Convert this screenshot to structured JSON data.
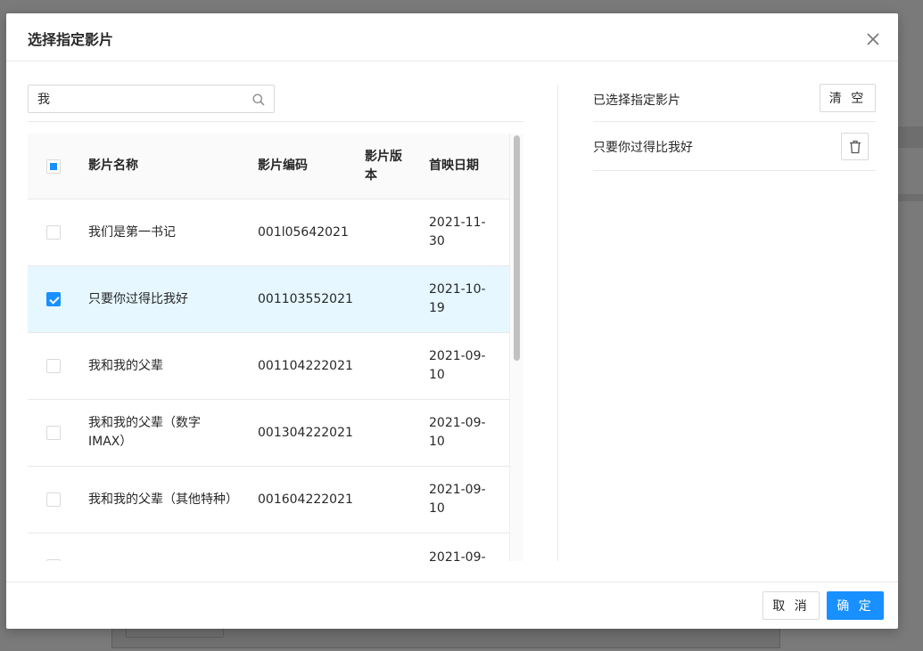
{
  "modal": {
    "title": "选择指定影片",
    "close_icon": "close-icon"
  },
  "search": {
    "value": "我",
    "placeholder": "",
    "icon": "search-icon"
  },
  "table": {
    "columns": [
      "影片名称",
      "影片编码",
      "影片版本",
      "首映日期"
    ],
    "rows": [
      {
        "name": "我们是第一书记",
        "code": "001l05642021",
        "version": "",
        "date": "2021-11-30",
        "checked": false
      },
      {
        "name": "只要你过得比我好",
        "code": "001103552021",
        "version": "",
        "date": "2021-10-19",
        "checked": true
      },
      {
        "name": "我和我的父辈",
        "code": "001104222021",
        "version": "",
        "date": "2021-09-10",
        "checked": false
      },
      {
        "name": "我和我的父辈（数字IMAX）",
        "code": "001304222021",
        "version": "",
        "date": "2021-09-10",
        "checked": false
      },
      {
        "name": "我和我的父辈（其他特种）",
        "code": "001604222021",
        "version": "",
        "date": "2021-09-10",
        "checked": false
      },
      {
        "name": "",
        "code": "",
        "version": "",
        "date": "2021-09-",
        "checked": false
      }
    ]
  },
  "selected_panel": {
    "title": "已选择指定影片",
    "clear_label": "清 空",
    "items": [
      {
        "name": "只要你过得比我好",
        "delete_icon": "trash-icon"
      }
    ]
  },
  "footer": {
    "cancel_label": "取 消",
    "ok_label": "确 定"
  },
  "colors": {
    "primary": "#1890ff",
    "selected_row": "#e6f7ff",
    "mask": "#7a7a7a"
  }
}
